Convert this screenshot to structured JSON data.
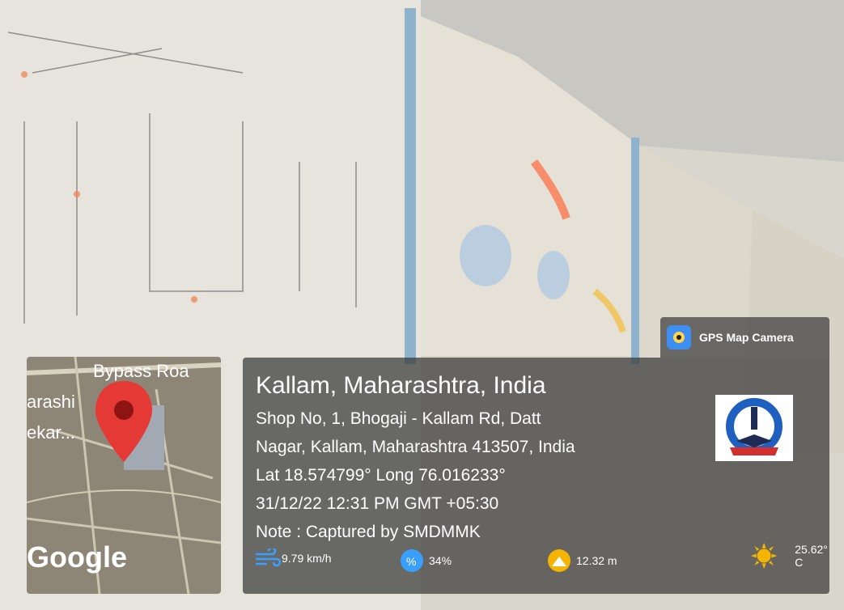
{
  "app": {
    "name": "GPS Map Camera"
  },
  "map": {
    "road_label": "Bypass Roa",
    "area_label_1": "arashi",
    "area_label_2": "ekar...",
    "brand": "Google"
  },
  "location": {
    "title": "Kallam, Maharashtra, India",
    "address_line1": "Shop No, 1, Bhogaji - Kallam Rd, Datt",
    "address_line2": "Nagar, Kallam, Maharashtra 413507, India",
    "coords": "Lat 18.574799° Long 76.016233°",
    "datetime": "31/12/22 12:31 PM GMT +05:30",
    "note": "Note : Captured by SMDMMK"
  },
  "weather": {
    "wind": "9.79 km/h",
    "humidity": "34%",
    "altitude": "12.32 m",
    "temperature": "25.62° C"
  },
  "colors": {
    "pin": "#e53935",
    "sun": "#f5b400",
    "badge_icon": "#3d8ef0",
    "wind_icon": "#3aa0ff"
  }
}
